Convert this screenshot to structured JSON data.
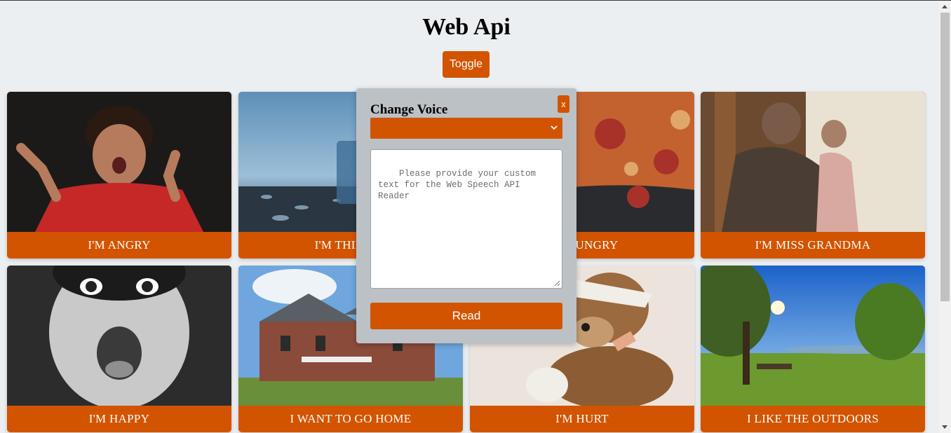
{
  "header": {
    "title": "Web Api",
    "toggle_label": "Toggle"
  },
  "cards": [
    {
      "label": "I'M ANGRY"
    },
    {
      "label": "I'M THIRSTY"
    },
    {
      "label": "I'M HUNGRY"
    },
    {
      "label": "I'M MISS GRANDMA"
    },
    {
      "label": "I'M HAPPY"
    },
    {
      "label": "I WANT TO GO HOME"
    },
    {
      "label": "I'M HURT"
    },
    {
      "label": "I LIKE THE OUTDOORS"
    }
  ],
  "modal": {
    "close_label": "x",
    "title": "Change Voice",
    "voice_select_value": "",
    "textarea_placeholder": "Please provide your custom text for the Web Speech API Reader",
    "read_label": "Read"
  },
  "colors": {
    "accent": "#d25400",
    "background": "#eceff1",
    "modal_bg": "#bcc1c5"
  }
}
